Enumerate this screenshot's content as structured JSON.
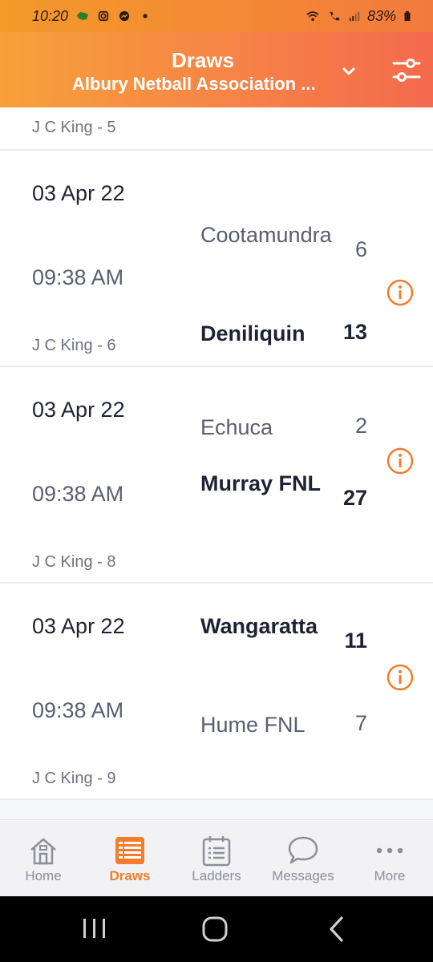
{
  "status_bar": {
    "time": "10:20",
    "battery": "83%"
  },
  "header": {
    "title": "Draws",
    "subtitle": "Albury Netball Association ..."
  },
  "first_row": {
    "venue": "J C King - 5"
  },
  "matches": [
    {
      "date": "03 Apr 22",
      "time": "09:38 AM",
      "venue": "J C King - 6",
      "home": {
        "name": "Cootamundra",
        "score": "6",
        "winner": false
      },
      "away": {
        "name": "Deniliquin",
        "score": "13",
        "winner": true
      }
    },
    {
      "date": "03 Apr 22",
      "time": "09:38 AM",
      "venue": "J C King - 8",
      "home": {
        "name": "Echuca",
        "score": "2",
        "winner": false
      },
      "away": {
        "name": "Murray FNL",
        "score": "27",
        "winner": true
      }
    },
    {
      "date": "03 Apr 22",
      "time": "09:38 AM",
      "venue": "J C King - 9",
      "home": {
        "name": "Wangaratta",
        "score": "11",
        "winner": true
      },
      "away": {
        "name": "Hume FNL",
        "score": "7",
        "winner": false
      }
    }
  ],
  "nav": {
    "items": [
      {
        "label": "Home",
        "icon": "home-icon"
      },
      {
        "label": "Draws",
        "icon": "draws-icon"
      },
      {
        "label": "Ladders",
        "icon": "ladders-icon"
      },
      {
        "label": "Messages",
        "icon": "messages-icon"
      },
      {
        "label": "More",
        "icon": "more-icon"
      }
    ],
    "active": "Draws"
  },
  "colors": {
    "accent": "#f47c2a",
    "header_start": "#f7a13a",
    "header_end": "#f36a4c",
    "text_dark": "#1f2233",
    "text_muted": "#6f7280"
  }
}
